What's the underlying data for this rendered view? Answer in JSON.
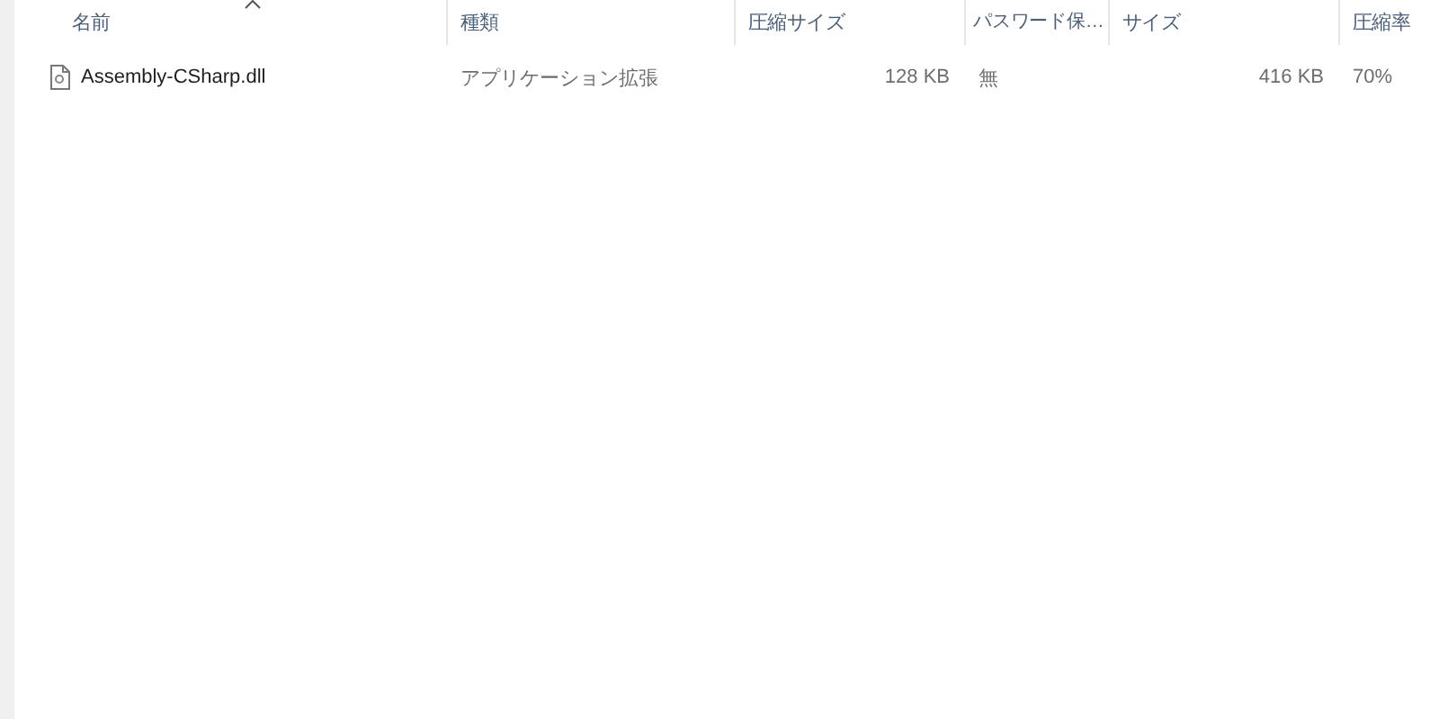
{
  "table": {
    "columns": [
      {
        "label": "名前",
        "sorted": true
      },
      {
        "label": "種類",
        "sorted": false
      },
      {
        "label": "圧縮サイズ",
        "sorted": false
      },
      {
        "label": "パスワード保…",
        "sorted": false
      },
      {
        "label": "サイズ",
        "sorted": false
      },
      {
        "label": "圧縮率",
        "sorted": false
      }
    ],
    "rows": [
      {
        "cells": [
          "Assembly-CSharp.dll",
          "アプリケーション拡張",
          "128 KB",
          "無",
          "416 KB",
          "70%"
        ]
      }
    ]
  }
}
